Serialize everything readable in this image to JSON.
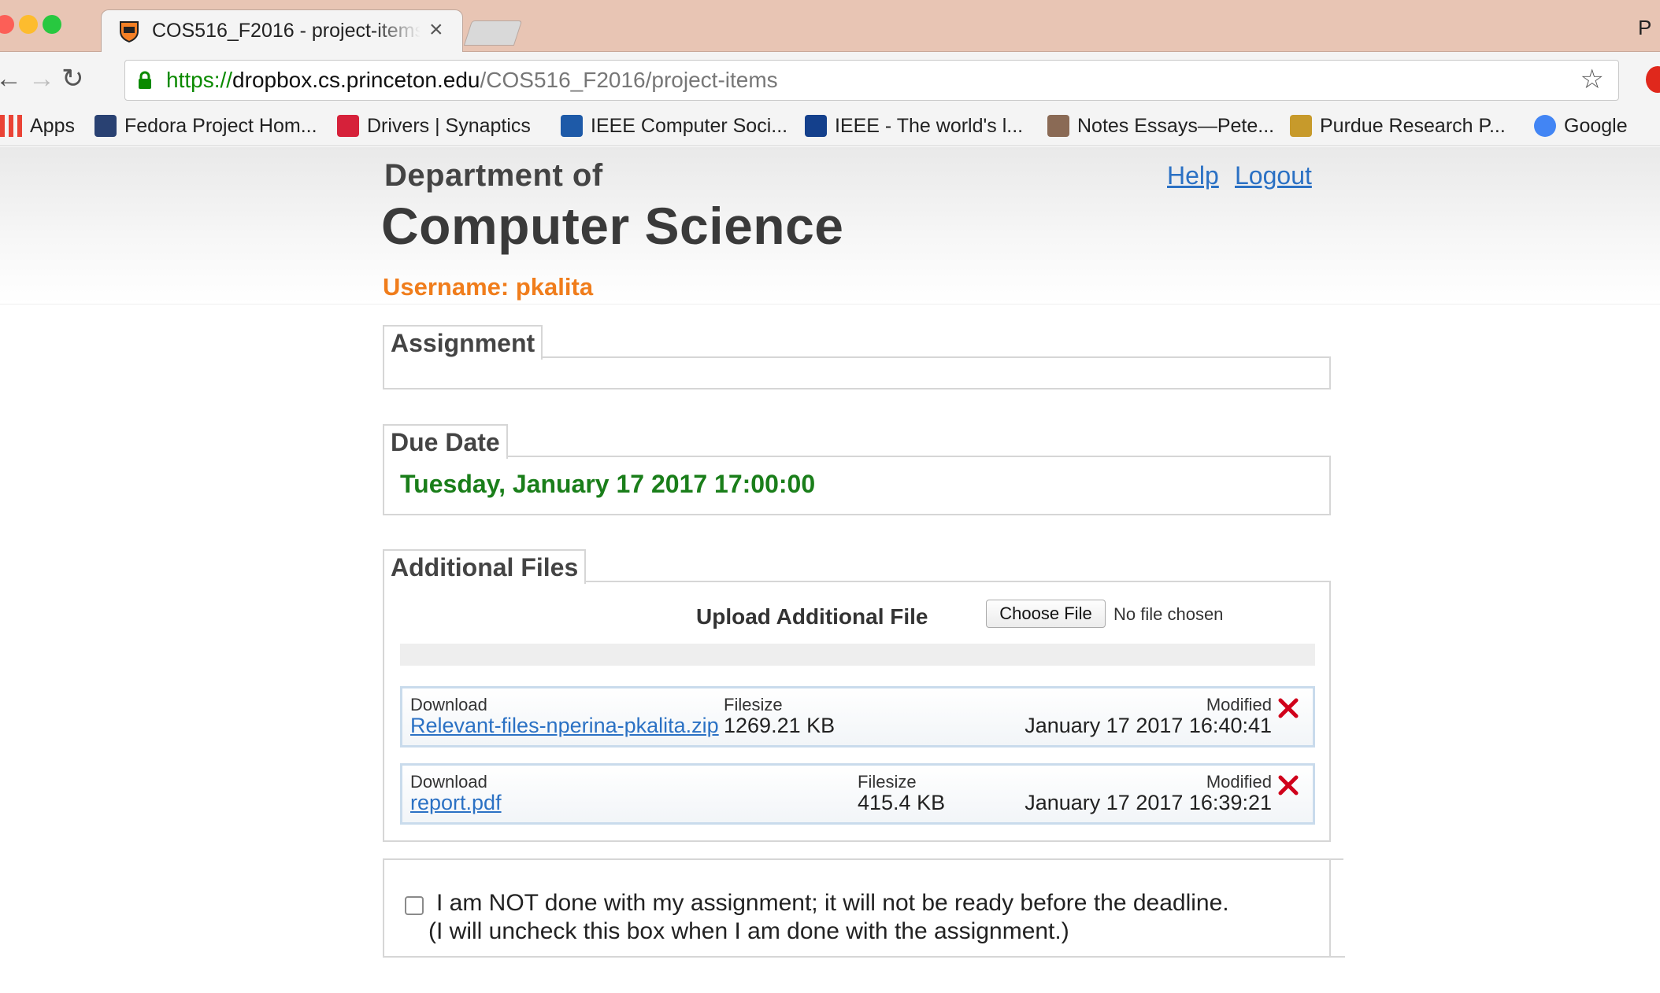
{
  "browser": {
    "tab_title": "COS516_F2016 - project-items",
    "profile_text": "P",
    "url_scheme": "https://",
    "url_host": "dropbox.cs.princeton.edu",
    "url_path": "/COS516_F2016/project-items",
    "bookmarks": [
      {
        "label": "Apps",
        "icon": "apps-grid-icon",
        "color": "#4285f4"
      },
      {
        "label": "Fedora Project Hom...",
        "icon": "fedora-icon",
        "color": "#294172"
      },
      {
        "label": "Drivers | Synaptics",
        "icon": "synaptics-icon",
        "color": "#d6213a"
      },
      {
        "label": "IEEE Computer Soci...",
        "icon": "ieee-cs-icon",
        "color": "#1e5aa8"
      },
      {
        "label": "IEEE - The world's l...",
        "icon": "ieee-icon",
        "color": "#14408c"
      },
      {
        "label": "Notes Essays—Pete...",
        "icon": "notes-essays-icon",
        "color": "#8a6a55"
      },
      {
        "label": "Purdue Research P...",
        "icon": "purdue-research-icon",
        "color": "#c79a2b"
      },
      {
        "label": "Google",
        "icon": "google-icon",
        "color": "#4285f4"
      }
    ]
  },
  "header": {
    "dept_line1": "Department of",
    "dept_line2": "Computer Science",
    "help": "Help",
    "logout": "Logout",
    "username": "Username: pkalita"
  },
  "assignment": {
    "legend": "Assignment"
  },
  "due_date": {
    "legend": "Due Date",
    "value": "Tuesday, January 17 2017 17:00:00"
  },
  "additional_files": {
    "legend": "Additional Files",
    "upload_label": "Upload Additional File",
    "choose_button": "Choose File",
    "no_file": "No file chosen",
    "col_download": "Download",
    "col_filesize": "Filesize",
    "col_modified": "Modified",
    "files": [
      {
        "name": "Relevant-files-nperina-pkalita.zip",
        "size": "1269.21 KB",
        "modified": "January 17 2017 16:40:41"
      },
      {
        "name": "report.pdf",
        "size": "415.4 KB",
        "modified": "January 17 2017 16:39:21"
      }
    ]
  },
  "not_done": {
    "checked": false,
    "line1": "I am NOT done with my assignment; it will not be ready before the deadline.",
    "line2": "(I will uncheck this box when I am done with the assignment.)"
  },
  "colors": {
    "accent_link": "#2b71c4",
    "username": "#f07d1c",
    "due_date": "#1a7e1a",
    "delete": "#d0021b"
  }
}
